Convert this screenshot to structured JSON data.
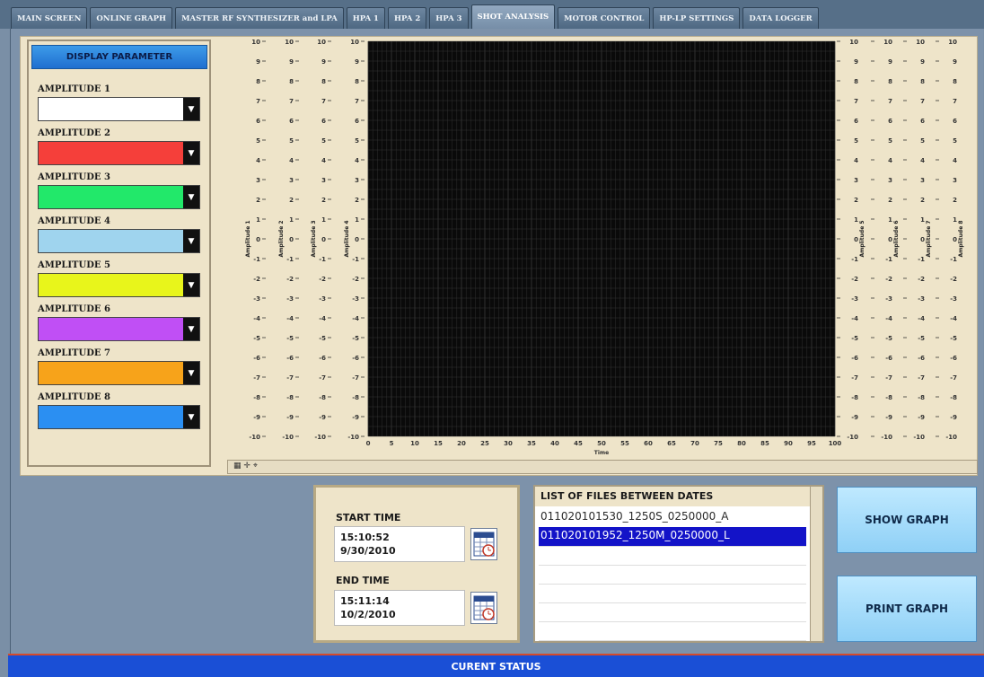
{
  "tabs": [
    {
      "label": "MAIN SCREEN",
      "active": false
    },
    {
      "label": "ONLINE GRAPH",
      "active": false
    },
    {
      "label": "MASTER RF SYNTHESIZER and LPA",
      "active": false
    },
    {
      "label": "HPA 1",
      "active": false
    },
    {
      "label": "HPA 2",
      "active": false
    },
    {
      "label": "HPA 3",
      "active": false
    },
    {
      "label": "SHOT ANALYSIS",
      "active": true
    },
    {
      "label": "MOTOR CONTROL",
      "active": false
    },
    {
      "label": "HP-LP SETTINGS",
      "active": false
    },
    {
      "label": "DATA LOGGER",
      "active": false
    }
  ],
  "display_parameter": {
    "header": "DISPLAY PARAMETER",
    "amplitudes": [
      {
        "label": "AMPLITUDE 1",
        "color": "#ffffff"
      },
      {
        "label": "AMPLITUDE 2",
        "color": "#f53f3a"
      },
      {
        "label": "AMPLITUDE 3",
        "color": "#22e86a"
      },
      {
        "label": "AMPLITUDE 4",
        "color": "#9fd4ee"
      },
      {
        "label": "AMPLITUDE 5",
        "color": "#e8f51b"
      },
      {
        "label": "AMPLITUDE 6",
        "color": "#c04ff5"
      },
      {
        "label": "AMPLITUDE 7",
        "color": "#f7a31a"
      },
      {
        "label": "AMPLITUDE 8",
        "color": "#2b8ff2"
      }
    ]
  },
  "chart_data": {
    "type": "line",
    "xlabel": "Time",
    "x_ticks": [
      0,
      5,
      10,
      15,
      20,
      25,
      30,
      35,
      40,
      45,
      50,
      55,
      60,
      65,
      70,
      75,
      80,
      85,
      90,
      95,
      100
    ],
    "y_ticks": [
      10,
      9,
      8,
      7,
      6,
      5,
      4,
      3,
      2,
      1,
      0,
      -1,
      -2,
      -3,
      -4,
      -5,
      -6,
      -7,
      -8,
      -9,
      -10
    ],
    "xlim": [
      0,
      100
    ],
    "ylim": [
      -10,
      10
    ],
    "left_axes": [
      "Amplitude 1",
      "Amplitude 2",
      "Amplitude 3",
      "Amplitude 4"
    ],
    "right_axes": [
      "Amplitude 5",
      "Amplitude 6",
      "Amplitude 7",
      "Amplitude 8"
    ],
    "grid": true,
    "plot_background": "#0a0a0a",
    "grid_color": "#3a3a3a",
    "series": []
  },
  "time_panel": {
    "start_label": "START TIME",
    "start_time": "15:10:52",
    "start_date": "9/30/2010",
    "end_label": "END TIME",
    "end_time": "15:11:14",
    "end_date": "10/2/2010"
  },
  "files": {
    "header": "LIST OF FILES BETWEEN DATES",
    "items": [
      {
        "name": "011020101530_1250S_0250000_A",
        "selected": false
      },
      {
        "name": "011020101952_1250M_0250000_L",
        "selected": true
      },
      {
        "name": "",
        "selected": false
      },
      {
        "name": "",
        "selected": false
      },
      {
        "name": "",
        "selected": false
      },
      {
        "name": "",
        "selected": false
      },
      {
        "name": "",
        "selected": false
      }
    ]
  },
  "buttons": {
    "show_graph": "SHOW GRAPH",
    "print_graph": "PRINT GRAPH"
  },
  "status": {
    "label": "CURENT STATUS"
  }
}
